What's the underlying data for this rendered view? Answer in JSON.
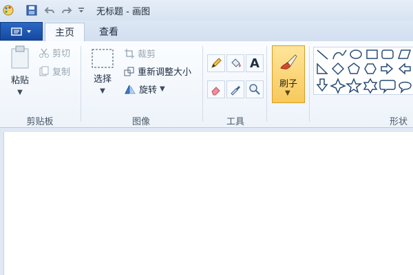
{
  "window": {
    "title": "无标题 - 画图"
  },
  "quick_access": {
    "icons": [
      "paint-app-icon",
      "save-icon",
      "undo-icon",
      "redo-icon",
      "customize-caret-icon"
    ]
  },
  "tabs": [
    {
      "label": "主页",
      "active": true
    },
    {
      "label": "查看",
      "active": false
    }
  ],
  "clipboard": {
    "paste_label": "粘贴",
    "cut_label": "剪切",
    "copy_label": "复制",
    "group_label": "剪贴板"
  },
  "image": {
    "select_label": "选择",
    "crop_label": "裁剪",
    "resize_label": "重新调整大小",
    "rotate_label": "旋转",
    "group_label": "图像"
  },
  "tools": {
    "group_label": "工具",
    "text_glyph": "A"
  },
  "brushes": {
    "label": "刷子"
  },
  "shapes": {
    "group_label": "形状",
    "icons": [
      "line-shape-icon",
      "curve-shape-icon",
      "oval-shape-icon",
      "rectangle-shape-icon",
      "rounded-rectangle-shape-icon",
      "polygon-shape-icon",
      "triangle-shape-icon",
      "diamond-shape-icon",
      "pentagon-shape-icon",
      "hexagon-shape-icon",
      "right-arrow-shape-icon",
      "left-arrow-shape-icon",
      "down-arrow-shape-icon",
      "four-point-star-shape-icon",
      "five-point-star-shape-icon",
      "six-point-star-shape-icon",
      "rounded-callout-shape-icon",
      "oval-callout-shape-icon"
    ]
  },
  "colors": {
    "accent": "#1a56b5",
    "brush_active": "#f7c95c"
  }
}
